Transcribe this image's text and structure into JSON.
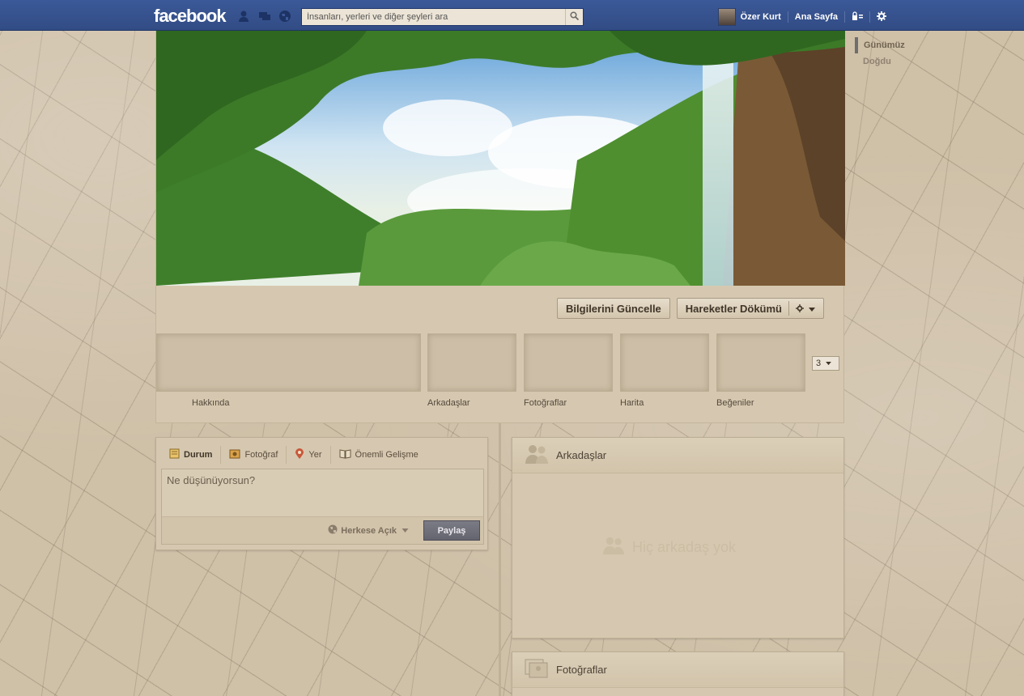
{
  "app": {
    "logo": "facebook"
  },
  "search": {
    "placeholder": "İnsanları, yerleri ve diğer şeyleri ara"
  },
  "user": {
    "name": "Özer Kurt"
  },
  "nav": {
    "home": "Ana Sayfa"
  },
  "scrubber": {
    "items": [
      "Günümüz",
      "Doğdu"
    ]
  },
  "profile": {
    "update_info": "Bilgilerini Güncelle",
    "activity_log": "Hareketler Dökümü"
  },
  "apps": {
    "items": [
      "Hakkında",
      "Arkadaşlar",
      "Fotoğraflar",
      "Harita",
      "Beğeniler"
    ],
    "count": "3"
  },
  "composer": {
    "tabs": [
      "Durum",
      "Fotoğraf",
      "Yer",
      "Önemli Gelişme"
    ],
    "placeholder": "Ne düşünüyorsun?",
    "privacy": "Herkese Açık",
    "share": "Paylaş"
  },
  "friends_panel": {
    "title": "Arkadaşlar",
    "empty": "Hiç arkadaş yok"
  },
  "photos_panel": {
    "title": "Fotoğraflar"
  },
  "colors": {
    "topbar": "#3b5998",
    "background": "#cfc0a8",
    "panel": "#d6c8b0",
    "share_button": "#6e6e78"
  }
}
